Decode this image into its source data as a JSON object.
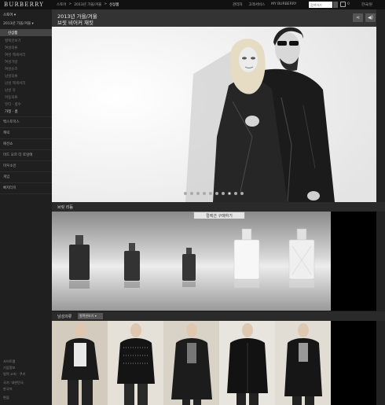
{
  "header": {
    "brand": "BURBERRY",
    "breadcrumb": [
      "스토어",
      "2013년 가을/겨울",
      "신상품"
    ],
    "links": [
      "관리자",
      "고객서비스",
      "MY BURBERRY"
    ],
    "search_placeholder": "검색하기",
    "bag_count": "0",
    "locale": "한국/원"
  },
  "sidebar": {
    "store": "스토어",
    "season": "2013년 가을/겨울",
    "new_label": "신상품",
    "sub_items": [
      "컬렉션보기",
      "여성의류",
      "여성 액세서리",
      "여성가방",
      "여성슈즈",
      "남성의류",
      "남성 액세서리",
      "남성 유",
      "아동의류",
      "뷰티 · 향수",
      "가정 · 홈"
    ],
    "categories": [
      "백스토미스",
      "캐릭",
      "패션쇼",
      "미드 오르 더 토밍에",
      "미우소인",
      "게임",
      "빠지터지"
    ],
    "footer": [
      "사이트맵",
      "기업정보",
      "법적 고지 · 쿠키",
      "국가: 대한민국",
      "한국어",
      "편집"
    ]
  },
  "hero": {
    "title_line1": "2013년 가을/겨울",
    "title_line2": "브릿 비어커 재킷",
    "share_icon": "share-icon",
    "sound_icon": "sound-icon",
    "slide_count": 10,
    "active_slide": 8
  },
  "fragrance": {
    "title": "브릿 리듬",
    "button": "컬렉션 구매하기"
  },
  "men": {
    "title": "남성의류",
    "select": "컬렉션보기"
  }
}
